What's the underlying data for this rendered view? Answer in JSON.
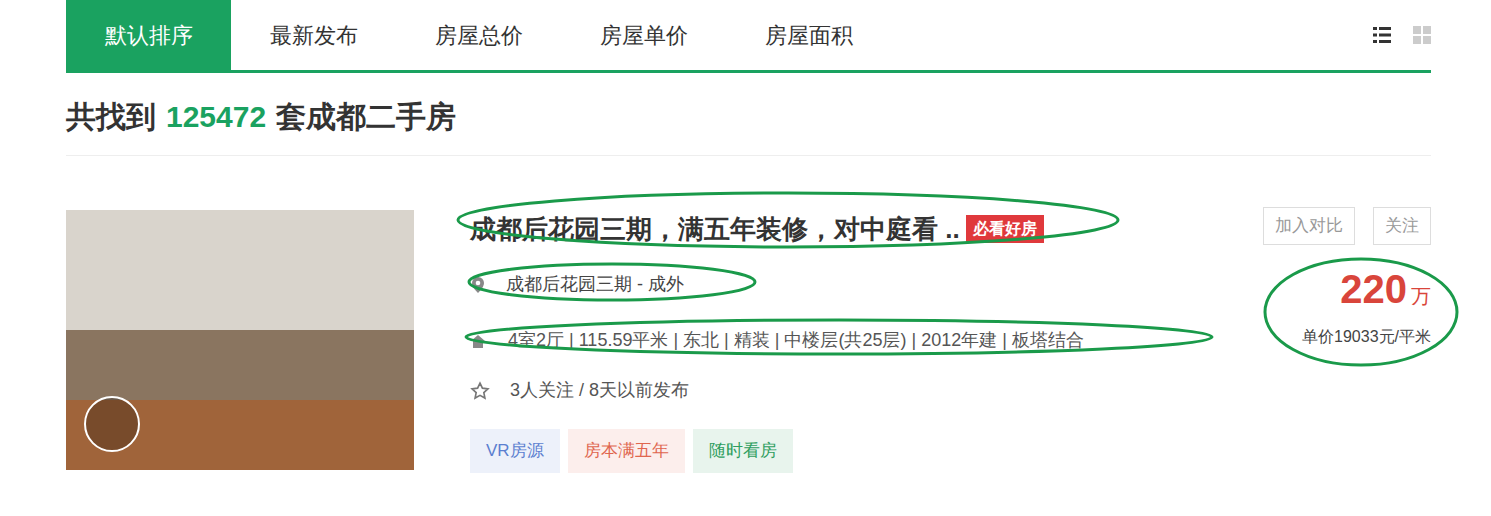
{
  "tabs": [
    {
      "label": "默认排序",
      "selected": true
    },
    {
      "label": "最新发布",
      "selected": false
    },
    {
      "label": "房屋总价",
      "selected": false
    },
    {
      "label": "房屋单价",
      "selected": false
    },
    {
      "label": "房屋面积",
      "selected": false
    }
  ],
  "view_toggle": [
    {
      "kind": "list",
      "selected": true
    },
    {
      "kind": "grid",
      "selected": false
    }
  ],
  "result_summary": {
    "prefix": "共找到",
    "count": "125472",
    "suffix": "套成都二手房"
  },
  "listings": [
    {
      "title": "成都后花园三期，满五年装修，对中庭看 ..",
      "badge": "必看好房",
      "actions": [
        "加入对比",
        "关注"
      ],
      "location": "成都后花园三期 - 成外",
      "info": "4室2厅 | 115.59平米 | 东北 | 精装 | 中楼层(共25层) | 2012年建 | 板塔结合",
      "followers": "3人关注 / 8天以前发布",
      "tags": [
        {
          "label": "VR房源",
          "color": "#5b7fd0"
        },
        {
          "label": "房本满五年",
          "color": "#e0664f"
        },
        {
          "label": "随时看房",
          "color": "#2f9e5f"
        }
      ],
      "price": "220",
      "price_unit": "万",
      "unit_price": "单价19033元/平米",
      "highlighted": {
        "title": true,
        "location": true,
        "info": true,
        "price": true
      }
    }
  ]
}
